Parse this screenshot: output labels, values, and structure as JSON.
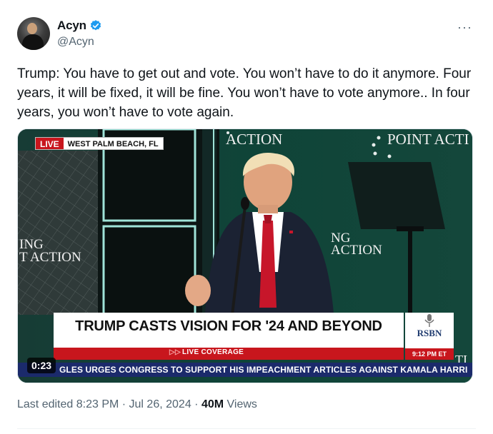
{
  "author": {
    "name": "Acyn",
    "handle": "@Acyn",
    "verified": true,
    "avatar_icon": "avatar-man-portrait"
  },
  "more_icon": "more-horizontal-icon",
  "tweet": {
    "text": "Trump: You have to get out and vote. You won’t have to do it anymore. Four years, it will be fixed, it will be fine. You won’t have to vote anymore.. In four years, you won’t have to vote again."
  },
  "video": {
    "live_label": "LIVE",
    "location": "WEST PALM BEACH, FL",
    "headline": "TRUMP CASTS VISION FOR '24 AND BEYOND",
    "coverage_label": "LIVE COVERAGE",
    "network": "RSBN",
    "broadcast_time": "9:12 PM ET",
    "ticker": "GLES URGES CONGRESS TO SUPPORT HIS IMPEACHMENT ARTICLES AGAINST KAMALA HARRI",
    "timer": "0:23",
    "backdrop_text": {
      "top_center": "ACTION",
      "top_right": "POINT ACTI",
      "left_line1": "ING",
      "left_line2": "T ACTION",
      "mid_line1": "NG",
      "mid_line2": "ACTION",
      "right_edge": "TI"
    },
    "colors": {
      "live_red": "#c8161d",
      "ticker_blue": "#1b2a6b",
      "backdrop_green": "#0d3f34"
    }
  },
  "meta": {
    "edited_label": "Last edited 8:23 PM · Jul 26, 2024 · ",
    "views_count": "40M",
    "views_label": " Views"
  }
}
